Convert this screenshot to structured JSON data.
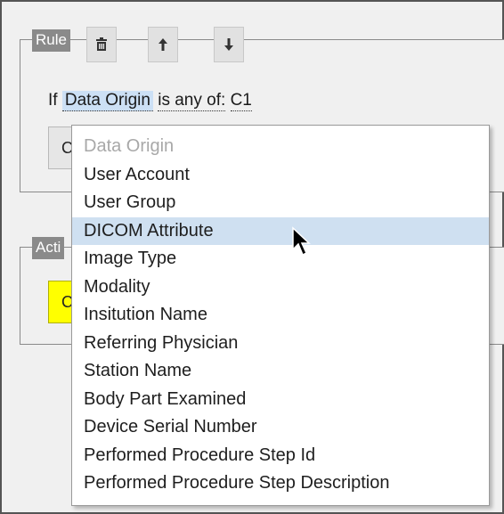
{
  "rule_panel": {
    "legend": "Rule",
    "toolbar": {
      "delete_icon": "trash-icon",
      "up_icon": "arrow-up-icon",
      "down_icon": "arrow-down-icon"
    },
    "condition": {
      "prefix": "If",
      "field": "Data Origin",
      "operator": "is any of:",
      "value": "C1"
    },
    "partial_button_text": "C"
  },
  "actions_panel": {
    "legend_partial": "Acti",
    "partial_button_text": "C"
  },
  "dropdown": {
    "options": [
      {
        "label": "Data Origin",
        "state": "disabled"
      },
      {
        "label": "User Account",
        "state": "normal"
      },
      {
        "label": "User Group",
        "state": "normal"
      },
      {
        "label": "DICOM Attribute",
        "state": "hover"
      },
      {
        "label": "Image Type",
        "state": "normal"
      },
      {
        "label": "Modality",
        "state": "normal"
      },
      {
        "label": "Insitution Name",
        "state": "normal"
      },
      {
        "label": "Referring Physician",
        "state": "normal"
      },
      {
        "label": "Station Name",
        "state": "normal"
      },
      {
        "label": "Body Part Examined",
        "state": "normal"
      },
      {
        "label": "Device Serial Number",
        "state": "normal"
      },
      {
        "label": "Performed Procedure Step Id",
        "state": "normal"
      },
      {
        "label": "Performed Procedure Step Description",
        "state": "normal"
      }
    ]
  },
  "colors": {
    "highlight": "#cfe0f1",
    "legend_bg": "#8a8a8a",
    "yellow_button": "#ffff00"
  }
}
